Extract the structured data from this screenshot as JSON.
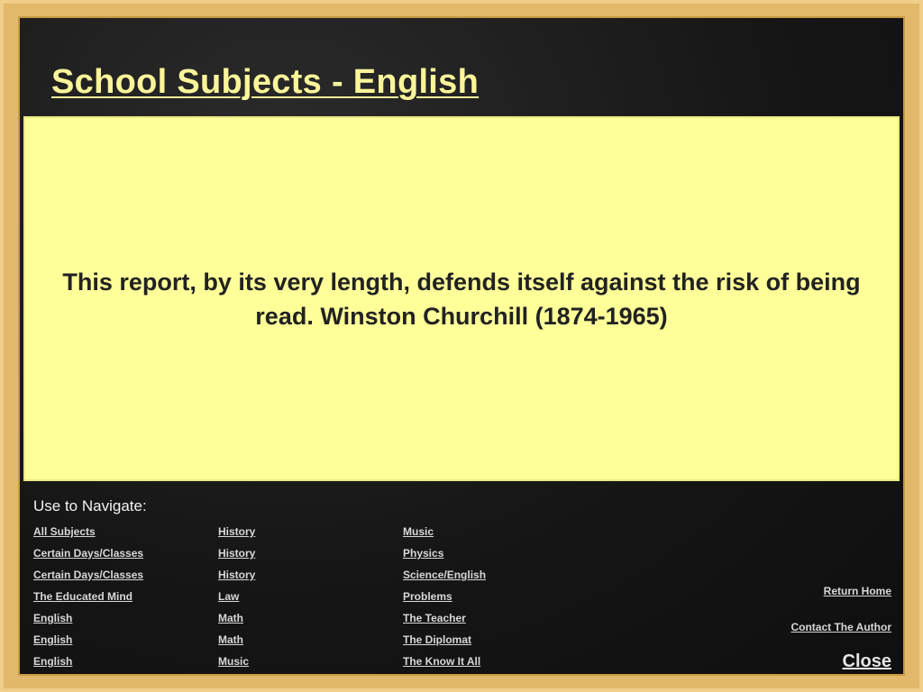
{
  "header": {
    "title": "School Subjects - English"
  },
  "quote": {
    "text": "This report, by its very length, defends itself against the risk of being read. Winston Churchill (1874-1965)"
  },
  "navigation": {
    "label": "Use to Navigate:",
    "col1": [
      "All Subjects",
      "Certain Days/Classes",
      "Certain Days/Classes",
      "The Educated Mind",
      "English",
      "English",
      "English"
    ],
    "col2": [
      "History",
      "History",
      "History",
      "Law",
      "Math",
      "Math",
      "Music"
    ],
    "col3": [
      "Music",
      "Physics",
      "Science/English",
      "Problems",
      "The Teacher",
      "The Diplomat",
      "The Know It All"
    ]
  },
  "actions": {
    "return_home": "Return Home",
    "contact_author": "Contact The Author",
    "close": "Close"
  },
  "colors": {
    "title": "#fbf59a",
    "panel": "#ffff99",
    "frame": "#e2b86a",
    "board": "#1a1a1a"
  }
}
